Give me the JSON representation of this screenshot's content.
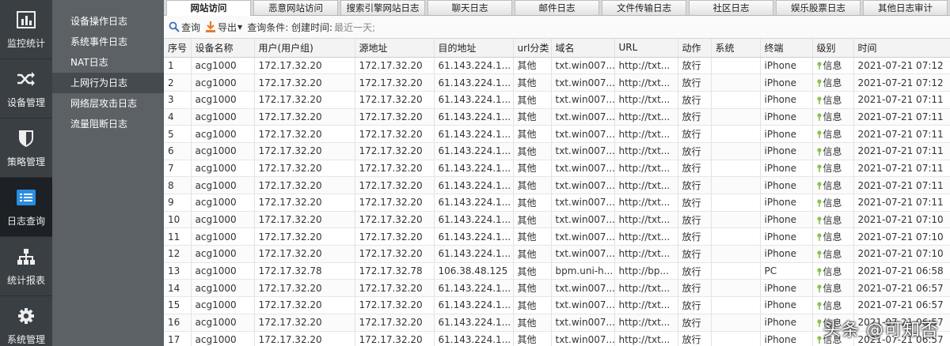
{
  "nav": {
    "items": [
      {
        "label": "监控统计",
        "icon": "bar-chart-icon"
      },
      {
        "label": "设备管理",
        "icon": "shuffle-icon"
      },
      {
        "label": "策略管理",
        "icon": "shield-icon"
      },
      {
        "label": "日志查询",
        "icon": "log-list-icon"
      },
      {
        "label": "统计报表",
        "icon": "org-chart-icon"
      },
      {
        "label": "系统管理",
        "icon": "gear-icon"
      }
    ]
  },
  "sidebar": {
    "items": [
      {
        "label": "设备操作日志"
      },
      {
        "label": "系统事件日志"
      },
      {
        "label": "NAT日志"
      },
      {
        "label": "上网行为日志"
      },
      {
        "label": "网络层攻击日志"
      },
      {
        "label": "流量阻断日志"
      }
    ]
  },
  "tabs": [
    {
      "label": "网站访问"
    },
    {
      "label": "恶意网站访问"
    },
    {
      "label": "搜索引擎网站日志"
    },
    {
      "label": "聊天日志"
    },
    {
      "label": "邮件日志"
    },
    {
      "label": "文件传输日志"
    },
    {
      "label": "社区日志"
    },
    {
      "label": "娱乐股票日志"
    },
    {
      "label": "其他日志审计"
    }
  ],
  "toolbar": {
    "query_label": "查询",
    "export_label": "导出",
    "condition_label": "查询条件: 创建时间:",
    "condition_value": "最近一天;"
  },
  "table": {
    "columns": [
      "序号",
      "设备名称",
      "用户(用户组)",
      "源地址",
      "目的地址",
      "url分类",
      "域名",
      "URL",
      "动作",
      "系统",
      "终端",
      "级别",
      "时间"
    ],
    "rows": [
      [
        "1",
        "acg1000",
        "172.17.32.20",
        "172.17.32.20",
        "61.143.224.1...",
        "其他",
        "txt.win007...",
        "http://txt...",
        "放行",
        "",
        "iPhone",
        "信息",
        "2021-07-21 07:12"
      ],
      [
        "2",
        "acg1000",
        "172.17.32.20",
        "172.17.32.20",
        "61.143.224.1...",
        "其他",
        "txt.win007...",
        "http://txt...",
        "放行",
        "",
        "iPhone",
        "信息",
        "2021-07-21 07:12"
      ],
      [
        "3",
        "acg1000",
        "172.17.32.20",
        "172.17.32.20",
        "61.143.224.1...",
        "其他",
        "txt.win007...",
        "http://txt...",
        "放行",
        "",
        "iPhone",
        "信息",
        "2021-07-21 07:11"
      ],
      [
        "4",
        "acg1000",
        "172.17.32.20",
        "172.17.32.20",
        "61.143.224.1...",
        "其他",
        "txt.win007...",
        "http://txt...",
        "放行",
        "",
        "iPhone",
        "信息",
        "2021-07-21 07:11"
      ],
      [
        "5",
        "acg1000",
        "172.17.32.20",
        "172.17.32.20",
        "61.143.224.1...",
        "其他",
        "txt.win007...",
        "http://txt...",
        "放行",
        "",
        "iPhone",
        "信息",
        "2021-07-21 07:11"
      ],
      [
        "6",
        "acg1000",
        "172.17.32.20",
        "172.17.32.20",
        "61.143.224.1...",
        "其他",
        "txt.win007...",
        "http://txt...",
        "放行",
        "",
        "iPhone",
        "信息",
        "2021-07-21 07:11"
      ],
      [
        "7",
        "acg1000",
        "172.17.32.20",
        "172.17.32.20",
        "61.143.224.1...",
        "其他",
        "txt.win007...",
        "http://txt...",
        "放行",
        "",
        "iPhone",
        "信息",
        "2021-07-21 07:11"
      ],
      [
        "8",
        "acg1000",
        "172.17.32.20",
        "172.17.32.20",
        "61.143.224.1...",
        "其他",
        "txt.win007...",
        "http://txt...",
        "放行",
        "",
        "iPhone",
        "信息",
        "2021-07-21 07:11"
      ],
      [
        "9",
        "acg1000",
        "172.17.32.20",
        "172.17.32.20",
        "61.143.224.1...",
        "其他",
        "txt.win007...",
        "http://txt...",
        "放行",
        "",
        "iPhone",
        "信息",
        "2021-07-21 07:11"
      ],
      [
        "10",
        "acg1000",
        "172.17.32.20",
        "172.17.32.20",
        "61.143.224.1...",
        "其他",
        "txt.win007...",
        "http://txt...",
        "放行",
        "",
        "iPhone",
        "信息",
        "2021-07-21 07:10"
      ],
      [
        "11",
        "acg1000",
        "172.17.32.20",
        "172.17.32.20",
        "61.143.224.1...",
        "其他",
        "txt.win007...",
        "http://txt...",
        "放行",
        "",
        "iPhone",
        "信息",
        "2021-07-21 07:10"
      ],
      [
        "12",
        "acg1000",
        "172.17.32.20",
        "172.17.32.20",
        "61.143.224.1...",
        "其他",
        "txt.win007...",
        "http://txt...",
        "放行",
        "",
        "iPhone",
        "信息",
        "2021-07-21 07:10"
      ],
      [
        "13",
        "acg1000",
        "172.17.32.78",
        "172.17.32.78",
        "106.38.48.125",
        "其他",
        "bpm.uni-h...",
        "http://bp...",
        "放行",
        "",
        "PC",
        "信息",
        "2021-07-21 06:58"
      ],
      [
        "14",
        "acg1000",
        "172.17.32.20",
        "172.17.32.20",
        "61.143.224.1...",
        "其他",
        "txt.win007...",
        "http://txt...",
        "放行",
        "",
        "iPhone",
        "信息",
        "2021-07-21 06:57"
      ],
      [
        "15",
        "acg1000",
        "172.17.32.20",
        "172.17.32.20",
        "61.143.224.1...",
        "其他",
        "txt.win007...",
        "http://txt...",
        "放行",
        "",
        "iPhone",
        "信息",
        "2021-07-21 06:57"
      ],
      [
        "16",
        "acg1000",
        "172.17.32.20",
        "172.17.32.20",
        "61.143.224.1...",
        "其他",
        "txt.win007...",
        "http://txt...",
        "放行",
        "",
        "iPhone",
        "信息",
        "2021-07-21 06:57"
      ],
      [
        "17",
        "acg1000",
        "172.17.32.20",
        "172.17.32.20",
        "61.143.224.1...",
        "其他",
        "txt.win007...",
        "http://txt...",
        "放行",
        "",
        "iPhone",
        "信息",
        "2021-07-21 06:57"
      ]
    ]
  },
  "watermark": "头条 @可知否",
  "colors": {
    "nav_bg": "#3a3f44",
    "sidebar_bg": "#5c6166",
    "level_icon": "#8bc34a",
    "export_icon": "#e8792b",
    "search_icon": "#3a6fb5"
  }
}
